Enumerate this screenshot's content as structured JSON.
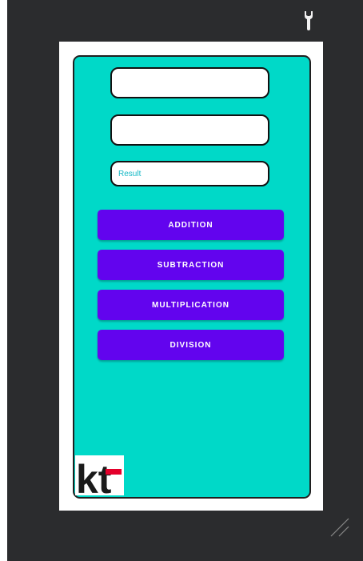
{
  "form": {
    "first_number": {
      "value": "",
      "placeholder": ""
    },
    "second_number": {
      "value": "",
      "placeholder": ""
    },
    "result": {
      "value": "",
      "placeholder": "Result"
    }
  },
  "buttons": {
    "addition": "ADDITION",
    "subtraction": "SUBTRACTION",
    "multiplication": "MULTIPLICATION",
    "division": "DIVISION"
  },
  "logo": {
    "text": "kt"
  },
  "icons": {
    "settings": "wrench-icon",
    "resize": "resize-grip-icon"
  },
  "colors": {
    "panel_bg": "#00d9c8",
    "button_bg": "#6204ee",
    "hint_text": "#13b8c5",
    "logo_red": "#e4002b",
    "frame_bg": "#2b2c2e"
  }
}
